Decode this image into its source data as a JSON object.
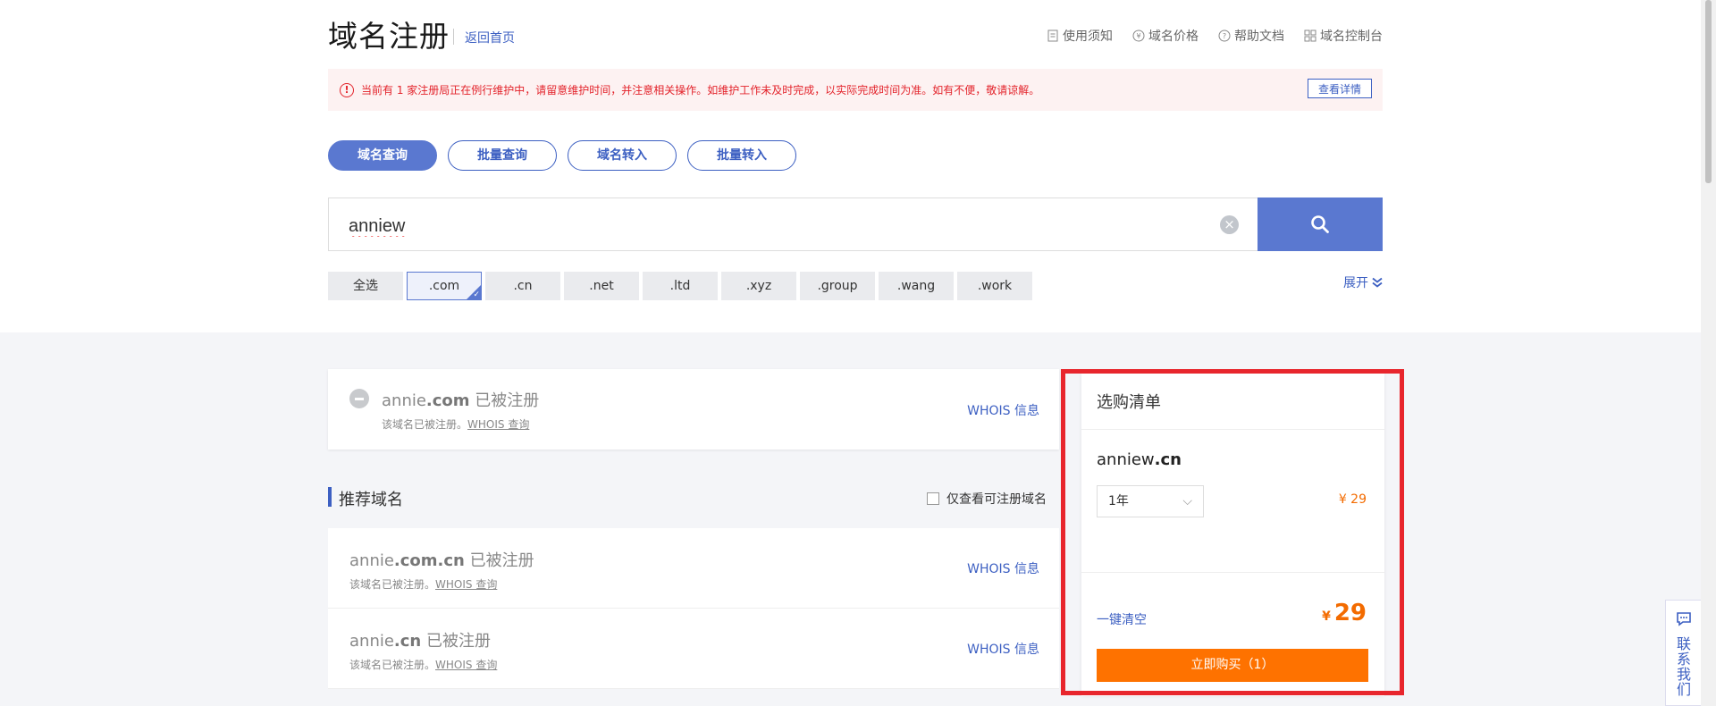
{
  "header": {
    "title": "域名注册",
    "back_link": "返回首页",
    "links": [
      {
        "icon": "doc-icon",
        "label": "使用须知"
      },
      {
        "icon": "yen-circle-icon",
        "label": "域名价格"
      },
      {
        "icon": "help-circle-icon",
        "label": "帮助文档"
      },
      {
        "icon": "grid-icon",
        "label": "域名控制台"
      }
    ]
  },
  "notice": {
    "text": "当前有 1 家注册局正在例行维护中，请留意维护时间，并注意相关操作。如维护工作未及时完成，以实际完成时间为准。如有不便，敬请谅解。",
    "button": "查看详情"
  },
  "tabs": [
    {
      "label": "域名查询",
      "active": true
    },
    {
      "label": "批量查询",
      "active": false
    },
    {
      "label": "域名转入",
      "active": false
    },
    {
      "label": "批量转入",
      "active": false
    }
  ],
  "search": {
    "value": "anniew"
  },
  "suffixes": {
    "items": [
      "全选",
      ".com",
      ".cn",
      ".net",
      ".ltd",
      ".xyz",
      ".group",
      ".wang",
      ".work"
    ],
    "selected": ".com",
    "expand_label": "展开"
  },
  "result": {
    "name": "annie",
    "tld": ".com",
    "status": "已被注册",
    "sub": "该域名已被注册。",
    "sub_link": "WHOIS 查询",
    "whois": "WHOIS 信息"
  },
  "recommend": {
    "title": "推荐域名",
    "filter_label": "仅查看可注册域名",
    "items": [
      {
        "name": "annie",
        "tld": ".com.cn",
        "status": "已被注册",
        "sub": "该域名已被注册。",
        "sub_link": "WHOIS 查询",
        "whois": "WHOIS 信息"
      },
      {
        "name": "annie",
        "tld": ".cn",
        "status": "已被注册",
        "sub": "该域名已被注册。",
        "sub_link": "WHOIS 查询",
        "whois": "WHOIS 信息"
      }
    ]
  },
  "cart": {
    "title": "选购清单",
    "domain_name": "anniew",
    "domain_tld": ".cn",
    "years": "1年",
    "price": "¥ 29",
    "clear": "一键清空",
    "total_currency": "¥",
    "total": "29",
    "buy": "立即购买（1）"
  },
  "contact": {
    "label": "联系我们",
    "icon": "chat-icon"
  },
  "colors": {
    "accent": "#5a78d0",
    "link": "#3c5fc2",
    "orange": "#fe7200",
    "alert": "#e3232b",
    "highlight_frame": "#e8262d"
  }
}
